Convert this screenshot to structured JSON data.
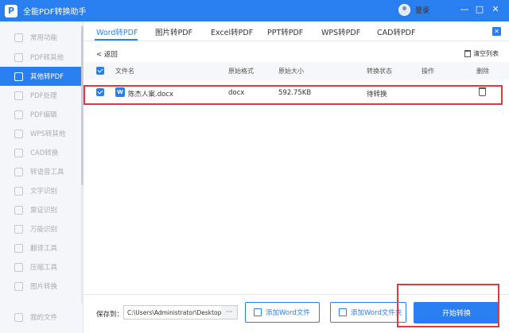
{
  "app": {
    "title": "全能PDF转换助手",
    "logo": "P",
    "login": "登录"
  },
  "window_controls": [
    "—",
    "□",
    "✕"
  ],
  "sidebar": {
    "items": [
      {
        "label": "常用功能",
        "icon": "star-icon"
      },
      {
        "label": "PDF转其他",
        "icon": "pdf-icon"
      },
      {
        "label": "其他转PDF",
        "icon": "convert-icon",
        "active": true
      },
      {
        "label": "PDF处理",
        "icon": "tools-icon"
      },
      {
        "label": "PDF编辑",
        "icon": "edit-icon"
      },
      {
        "label": "WPS转其他",
        "icon": "wps-icon"
      },
      {
        "label": "CAD转换",
        "icon": "cad-icon"
      },
      {
        "label": "转语音工具",
        "icon": "voice-icon"
      },
      {
        "label": "文字识别",
        "icon": "ocr-icon"
      },
      {
        "label": "票证识别",
        "icon": "ticket-icon"
      },
      {
        "label": "万能识别",
        "icon": "scan-icon"
      },
      {
        "label": "翻译工具",
        "icon": "translate-icon"
      },
      {
        "label": "压缩工具",
        "icon": "compress-icon"
      },
      {
        "label": "图片转换",
        "icon": "image-icon"
      },
      {
        "label": "我的文件",
        "icon": "folder-icon"
      }
    ]
  },
  "tabs": [
    {
      "label": "Word转PDF",
      "active": true
    },
    {
      "label": "图片转PDF"
    },
    {
      "label": "Excel转PDF"
    },
    {
      "label": "PPT转PDF"
    },
    {
      "label": "WPS转PDF"
    },
    {
      "label": "CAD转PDF"
    }
  ],
  "tab_close": "✕",
  "toolbar": {
    "back": "< 返回",
    "clear": "清空列表"
  },
  "table": {
    "headers": [
      "文件名",
      "原始格式",
      "原始大小",
      "转换状态",
      "操作",
      "删除"
    ],
    "rows": [
      {
        "icon_text": "W",
        "name": "陈杰人案.docx",
        "format": "docx",
        "size": "592.75KB",
        "status": "待转换"
      }
    ]
  },
  "bottom": {
    "save_label": "保存到：",
    "save_path": "C:\\Users\\Administrator\\Desktop",
    "browse": "···",
    "add_file": "添加Word文件",
    "add_folder": "添加Word文件夹",
    "start": "开始转换"
  },
  "colors": {
    "accent": "#2a7ff0",
    "highlight": "#e0393e",
    "sidebar_bg": "#f4f6f9"
  }
}
